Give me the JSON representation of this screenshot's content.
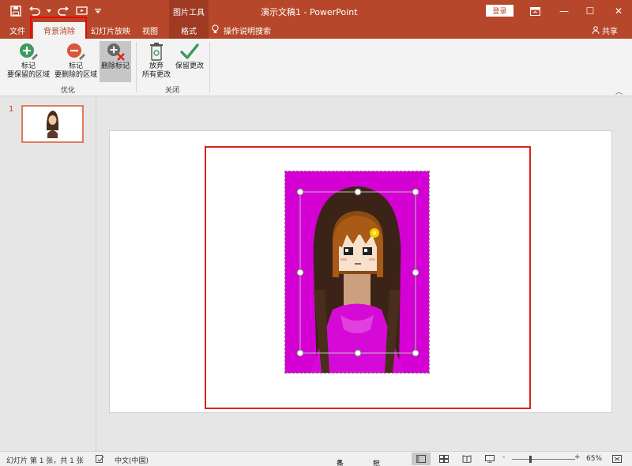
{
  "titlebar": {
    "context_tools": "图片工具",
    "doc_title": "演示文稿1  -  PowerPoint",
    "login": "登录",
    "minimize": "—",
    "maximize": "☐",
    "close": "✕"
  },
  "tabs": {
    "file": "文件",
    "background_removal": "背景消除",
    "slideshow": "幻灯片放映",
    "view": "视图",
    "format": "格式",
    "tell_me": "操作说明搜索",
    "share": "共享"
  },
  "ribbon": {
    "mark_keep_l1": "标记",
    "mark_keep_l2": "要保留的区域",
    "mark_remove_l1": "标记",
    "mark_remove_l2": "要删除的区域",
    "delete_mark": "删除标记",
    "discard_l1": "放弃",
    "discard_l2": "所有更改",
    "keep_changes": "保留更改",
    "group_refine": "优化",
    "group_close": "关闭",
    "collapse": "︿"
  },
  "thumbs": {
    "slide_number": "1"
  },
  "status": {
    "slide_info": "幻灯片 第 1 张，共 1 张",
    "language": "中文(中国)",
    "notes": "备注",
    "comments": "批注",
    "zoom_minus": "-",
    "zoom_plus": "+",
    "zoom": "65%"
  },
  "colors": {
    "accent": "#b7472a",
    "magenta": "#d400d4",
    "frame_red": "#d9251c"
  }
}
